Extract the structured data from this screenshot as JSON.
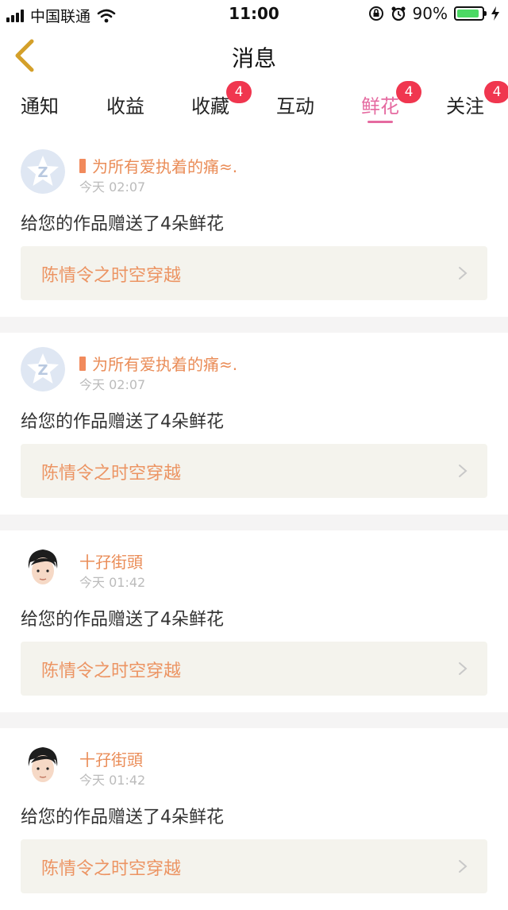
{
  "status": {
    "carrier": "中国联通",
    "time": "11:00",
    "battery": "90%",
    "battery_level": 0.9,
    "icons": [
      "signal-icon",
      "wifi-icon",
      "orientation-lock-icon",
      "alarm-icon",
      "battery-icon",
      "charging-icon"
    ]
  },
  "header": {
    "title": "消息",
    "back_icon": "chevron-left-icon"
  },
  "tabs": [
    {
      "label": "通知"
    },
    {
      "label": "收益"
    },
    {
      "label": "收藏",
      "badge": "4"
    },
    {
      "label": "互动"
    },
    {
      "label": "鲜花",
      "badge": "4",
      "active": true
    },
    {
      "label": "关注",
      "badge": "4"
    }
  ],
  "messages": [
    {
      "user": "为所有爱执着的痛≈.",
      "time": "今天 02:07",
      "text": "给您的作品赠送了4朵鲜花",
      "work": "陈情令之时空穿越",
      "avatar": "qq-star-avatar"
    },
    {
      "user": "为所有爱执着的痛≈.",
      "time": "今天 02:07",
      "text": "给您的作品赠送了4朵鲜花",
      "work": "陈情令之时空穿越",
      "avatar": "qq-star-avatar"
    },
    {
      "user": "十孖街頭",
      "time": "今天 01:42",
      "text": "给您的作品赠送了4朵鲜花",
      "work": "陈情令之时空穿越",
      "avatar": "boy-avatar"
    },
    {
      "user": "十孖街頭",
      "time": "今天 01:42",
      "text": "给您的作品赠送了4朵鲜花",
      "work": "陈情令之时空穿越",
      "avatar": "boy-avatar"
    }
  ],
  "colors": {
    "accent": "#e56aa0",
    "badge": "#f0364f",
    "username": "#ea8c57",
    "work_title": "#ec9463",
    "back": "#d4a02a"
  }
}
